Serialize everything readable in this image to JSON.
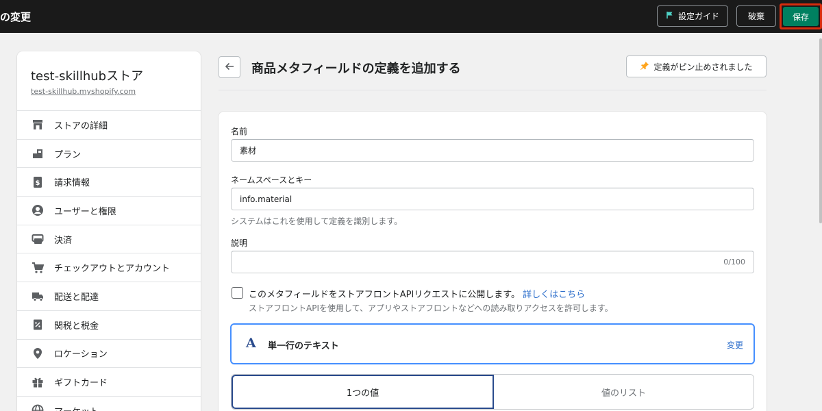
{
  "topbar": {
    "title": "の変更",
    "guide_label": "設定ガイド",
    "discard_label": "破棄",
    "save_label": "保存"
  },
  "sidebar": {
    "store_name": "test-skillhubストア",
    "store_url": "test-skillhub.myshopify.com",
    "items": [
      {
        "label": "ストアの詳細",
        "icon": "store-icon"
      },
      {
        "label": "プラン",
        "icon": "plan-icon"
      },
      {
        "label": "請求情報",
        "icon": "billing-icon"
      },
      {
        "label": "ユーザーと権限",
        "icon": "user-icon"
      },
      {
        "label": "決済",
        "icon": "payment-icon"
      },
      {
        "label": "チェックアウトとアカウント",
        "icon": "cart-icon"
      },
      {
        "label": "配送と配達",
        "icon": "truck-icon"
      },
      {
        "label": "関税と税金",
        "icon": "tax-icon"
      },
      {
        "label": "ロケーション",
        "icon": "location-icon"
      },
      {
        "label": "ギフトカード",
        "icon": "gift-icon"
      },
      {
        "label": "マーケット",
        "icon": "globe-icon"
      }
    ]
  },
  "header": {
    "title": "商品メタフィールドの定義を追加する",
    "pin_label": "定義がピン止めされました"
  },
  "form": {
    "name_label": "名前",
    "name_value": "素材",
    "key_label": "ネームスペースとキー",
    "key_value": "info.material",
    "key_help": "システムはこれを使用して定義を識別します。",
    "desc_label": "説明",
    "desc_value": "",
    "desc_counter": "0/100",
    "publish_text": "このメタフィールドをストアフロントAPIリクエストに公開します。",
    "publish_link": "詳しくはこちら",
    "publish_help": "ストアフロントAPIを使用して、アプリやストアフロントなどへの読み取りアクセスを許可します。",
    "publish_checked": false,
    "type_icon": "A",
    "type_label": "単一行のテキスト",
    "type_change": "変更",
    "value_options": [
      "1つの値",
      "値のリスト"
    ],
    "value_selected": "1つの値"
  },
  "colors": {
    "topbar_bg": "#1a1a1a",
    "save_bg": "#008060",
    "highlight": "#d72c0d",
    "link": "#2c6ecb",
    "focus": "#458fff"
  }
}
